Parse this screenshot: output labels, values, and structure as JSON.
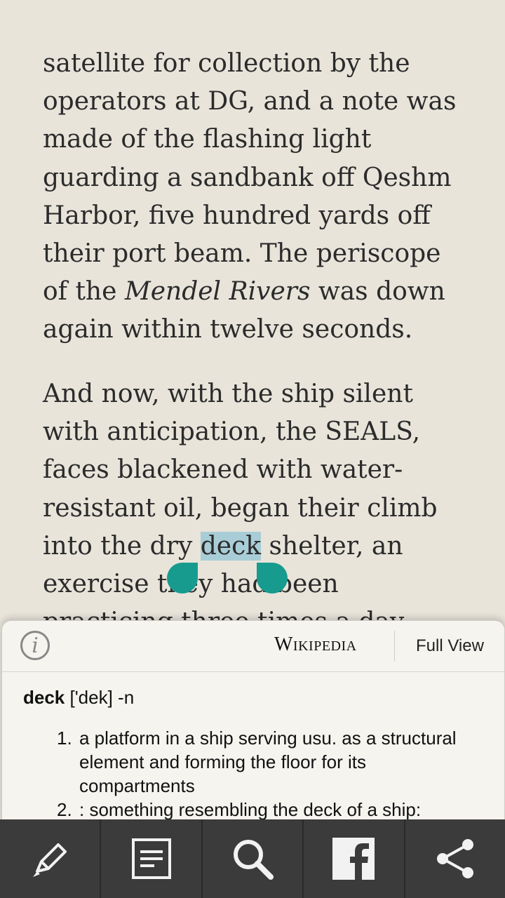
{
  "reader": {
    "paragraph1": [
      "satellite for collection by the",
      "operators at DG, and a note was",
      "made of the flashing light",
      "guarding a sandbank off Qeshm",
      "Harbor, five hundred yards off",
      "their port beam. The periscope",
      "of the ",
      "Mendel Rivers",
      " was down",
      "again within twelve seconds."
    ],
    "paragraph2": [
      "And now, with the ship silent",
      "with anticipation, the SEALS,",
      "faces blackened with water-",
      "resistant oil, began their climb",
      "into the dry ",
      "deck",
      " shelter, an",
      "exercise they had been",
      "practicing three times a day"
    ],
    "selected_word": "deck"
  },
  "popup": {
    "info_label": "i",
    "source": "Wikipedia",
    "full_view": "Full View",
    "headword": "deck",
    "pronunciation": " ['dek] -n",
    "definitions": [
      {
        "num": "1.",
        "text": "a platform in a ship serving usu. as a structural element and forming the floor for its compartments"
      },
      {
        "num": "2.",
        "text": ": something resembling the deck of a ship:"
      }
    ]
  },
  "toolbar": {
    "items": [
      "highlight-icon",
      "notes-icon",
      "search-icon",
      "facebook-icon",
      "share-icon"
    ]
  },
  "colors": {
    "background": "#e8e4da",
    "selection": "#a9cdd6",
    "handle": "#179b8e",
    "toolbar": "#3b3b3b"
  }
}
